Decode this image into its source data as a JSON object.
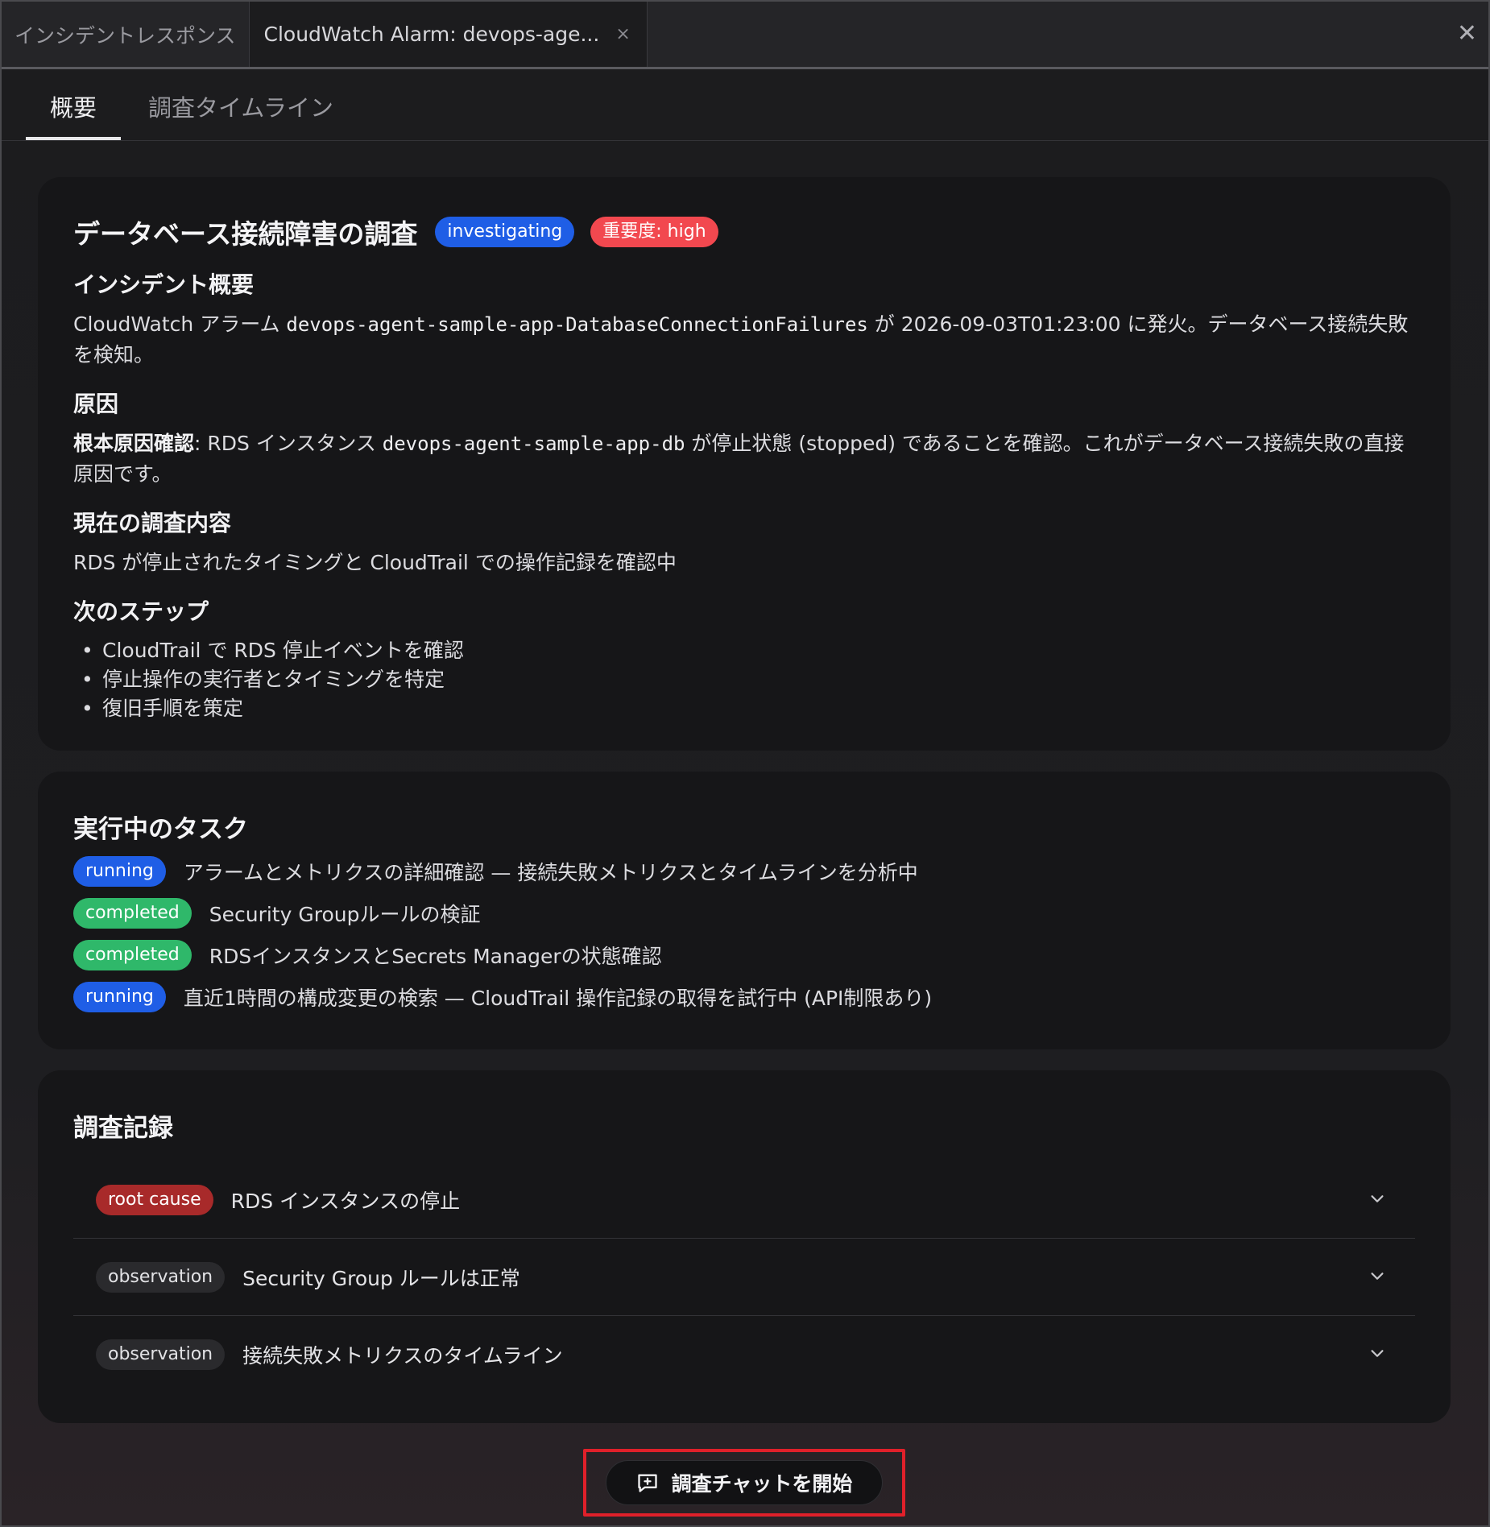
{
  "window_tabs": {
    "tab1": "インシデントレスポンス",
    "tab2": "CloudWatch Alarm: devops-age...",
    "tab_close": "×",
    "window_close": "✕"
  },
  "sub_tabs": {
    "overview": "概要",
    "timeline": "調査タイムライン"
  },
  "summary": {
    "title": "データベース接続障害の調査",
    "status_badge": "investigating",
    "severity_badge": "重要度: high",
    "incident_heading": "インシデント概要",
    "incident_p1": "CloudWatch アラーム ",
    "incident_alarm": "devops-agent-sample-app-DatabaseConnectionFailures",
    "incident_p2": " が 2026-09-03T01:23:00 に発火。データベース接続失敗を検知。",
    "cause_heading": "原因",
    "cause_strong": "根本原因確認",
    "cause_p1": ": RDS インスタンス ",
    "cause_db": "devops-agent-sample-app-db",
    "cause_p2": " が停止状態 (stopped) であることを確認。これがデータベース接続失敗の直接原因です。",
    "current_heading": "現在の調査内容",
    "current_text": "RDS が停止されたタイミングと CloudTrail での操作記録を確認中",
    "next_heading": "次のステップ",
    "next_steps": [
      "CloudTrail で RDS 停止イベントを確認",
      "停止操作の実行者とタイミングを特定",
      "復旧手順を策定"
    ]
  },
  "tasks": {
    "heading": "実行中のタスク",
    "items": [
      {
        "status": "running",
        "text": "アラームとメトリクスの詳細確認 — 接続失敗メトリクスとタイムラインを分析中"
      },
      {
        "status": "completed",
        "text": "Security Groupルールの検証"
      },
      {
        "status": "completed",
        "text": "RDSインスタンスとSecrets Managerの状態確認"
      },
      {
        "status": "running",
        "text": "直近1時間の構成変更の検索 — CloudTrail 操作記録の取得を試行中 (API制限あり)"
      }
    ]
  },
  "records": {
    "heading": "調査記録",
    "items": [
      {
        "type": "root cause",
        "text": "RDS インスタンスの停止"
      },
      {
        "type": "observation",
        "text": "Security Group ルールは正常"
      },
      {
        "type": "observation",
        "text": "接続失敗メトリクスのタイムライン"
      }
    ]
  },
  "start_chat": {
    "label": "調査チャットを開始"
  },
  "colors": {
    "running": "#1f5ee6",
    "completed": "#2fb86a",
    "severity": "#f2484f",
    "root_cause": "#a82a2a",
    "highlight_border": "#e0202a"
  },
  "icons": [
    "close-icon",
    "chevron-down-icon",
    "chat-plus-icon"
  ]
}
